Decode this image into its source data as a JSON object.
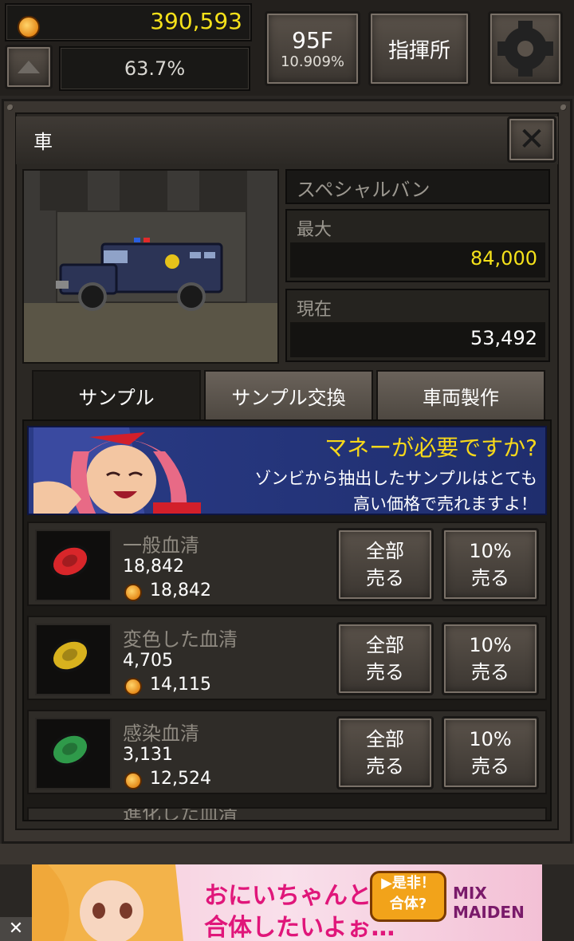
{
  "hud": {
    "money": "390,593",
    "progress": "63.7%",
    "floor": "95F",
    "floor_sub": "10.909%",
    "hq_label": "指揮所"
  },
  "panel": {
    "title": "車",
    "vehicle_name": "スペシャルバン",
    "max_label": "最大",
    "max_value": "84,000",
    "current_label": "現在",
    "current_value": "53,492"
  },
  "tabs": [
    {
      "label": "サンプル",
      "active": true
    },
    {
      "label": "サンプル交換",
      "active": false
    },
    {
      "label": "車両製作",
      "active": false
    }
  ],
  "banner": {
    "title": "マネーが必要ですか?",
    "line1": "ゾンビから抽出したサンプルはとても",
    "line2": "高い価格で売れますよ！"
  },
  "samples": [
    {
      "name": "一般血清",
      "quantity": "18,842",
      "price": "18,842",
      "color": "#d8262a",
      "sell_all": [
        "全部",
        "売る"
      ],
      "sell_10": [
        "10%",
        "売る"
      ]
    },
    {
      "name": "変色した血清",
      "quantity": "4,705",
      "price": "14,115",
      "color": "#d8b21e",
      "sell_all": [
        "全部",
        "売る"
      ],
      "sell_10": [
        "10%",
        "売る"
      ]
    },
    {
      "name": "感染血清",
      "quantity": "3,131",
      "price": "12,524",
      "color": "#2f9a4a",
      "sell_all": [
        "全部",
        "売る"
      ],
      "sell_10": [
        "10%",
        "売る"
      ]
    }
  ],
  "partial_row_name": "進化した血清",
  "ad": {
    "text1": "おにいちゃんと",
    "text2": "合体したいよぉ…",
    "button_l1": "▶是非！",
    "button_l2": "合体?",
    "logo": "MIX MAIDEN",
    "close": "✕"
  },
  "colors": {
    "money_yellow": "#f5e11a",
    "max_yellow": "#f5e11a",
    "banner_blue": "#2a3b86"
  }
}
